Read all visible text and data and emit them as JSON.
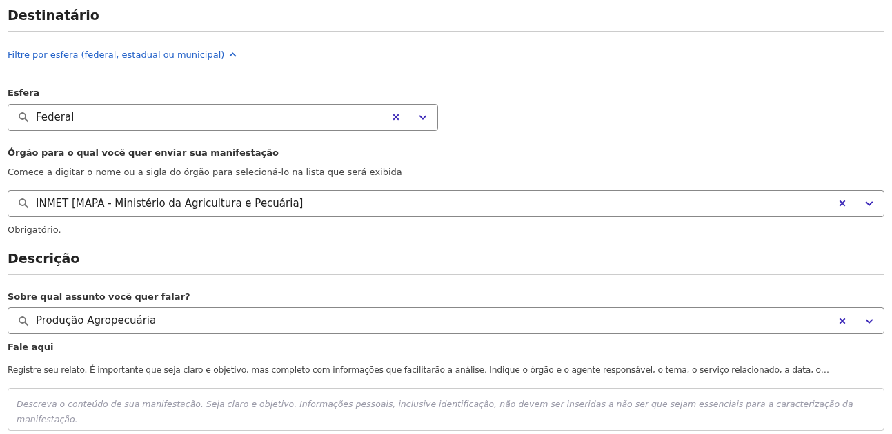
{
  "sections": [
    {
      "title": "Destinatário",
      "filter": {
        "label": "Filtre por esfera (federal, estadual ou municipal)",
        "expanded": true,
        "fields": [
          {
            "kind": "select",
            "label": "Esfera",
            "value": "Federal"
          }
        ]
      },
      "fields": [
        {
          "kind": "select",
          "label": "Órgão para o qual você quer enviar sua manifestação",
          "hint": "Comece a digitar o nome ou a sigla do órgão para selecioná-lo na lista que será exibida",
          "value": "INMET [MAPA - Ministério da Agricultura e Pecuária]",
          "note": "Obrigatório."
        }
      ]
    },
    {
      "title": "Descrição",
      "fields": [
        {
          "kind": "select",
          "label": "Sobre qual assunto você quer falar?",
          "value": "Produção Agropecuária"
        },
        {
          "kind": "textarea",
          "label": "Fale aqui",
          "hint": "Registre seu relato. É importante que seja claro e objetivo, mas completo com informações que facilitarão a análise. Indique o órgão e o agente responsável, o tema, o serviço relacionado, a data, o…",
          "placeholder": "Descreva o conteúdo de sua manifestação. Seja claro e objetivo. Informações pessoais, inclusive identificação, não devem ser inseridas a não ser que sejam essenciais para a caracterização da manifestação."
        }
      ]
    }
  ]
}
